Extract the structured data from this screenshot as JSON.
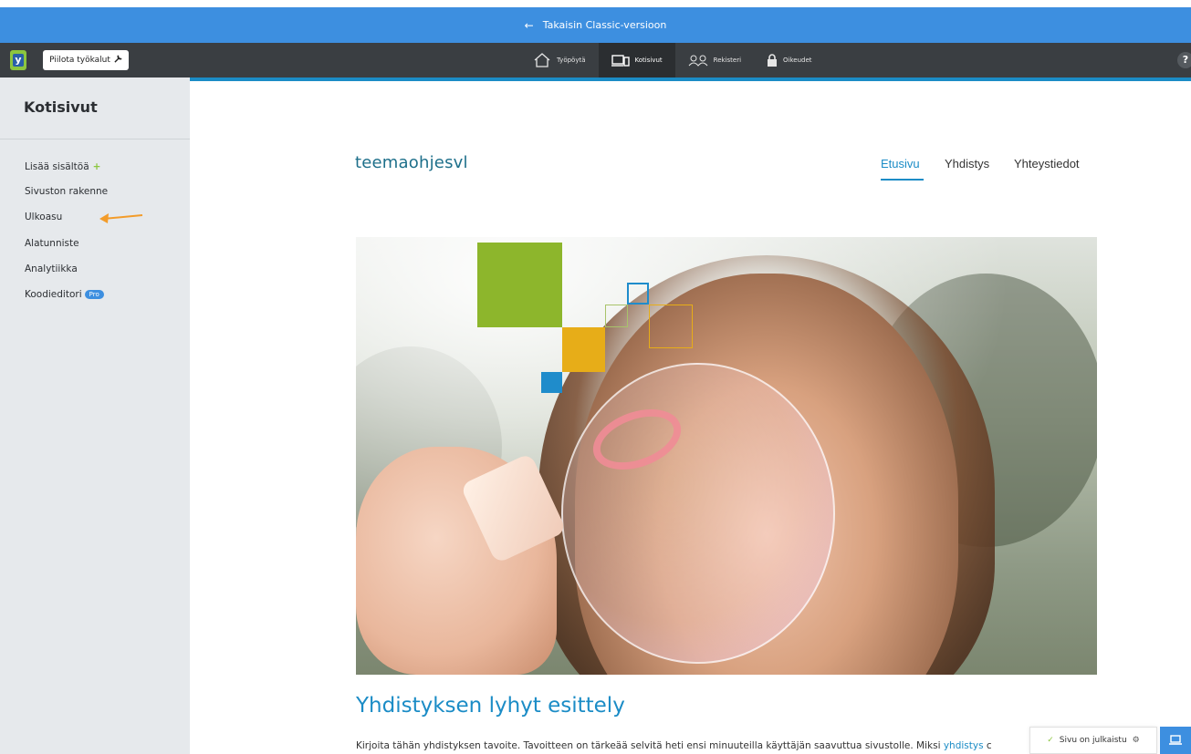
{
  "banner": {
    "back_label": "Takaisin Classic-versioon"
  },
  "toolbar": {
    "logo_letter": "y",
    "hide_tools_label": "Piilota työkalut",
    "nav": [
      {
        "label": "Työpöytä",
        "icon": "home-icon"
      },
      {
        "label": "Kotisivut",
        "icon": "devices-icon",
        "active": true
      },
      {
        "label": "Rekisteri",
        "icon": "people-icon"
      },
      {
        "label": "Oikeudet",
        "icon": "lock-icon"
      }
    ],
    "help_label": "?"
  },
  "sidebar": {
    "title": "Kotisivut",
    "items": [
      {
        "label": "Lisää sisältöä",
        "suffix": "+"
      },
      {
        "label": "Sivuston rakenne"
      },
      {
        "label": "Ulkoasu"
      },
      {
        "label": "Alatunniste"
      },
      {
        "label": "Analytiikka"
      },
      {
        "label": "Koodieditori",
        "badge": "Pro"
      }
    ]
  },
  "site": {
    "logo": "teemaohjesvl",
    "nav": [
      "Etusivu",
      "Yhdistys",
      "Yhteystiedot"
    ],
    "active_nav": "Etusivu",
    "heading": "Yhdistyksen lyhyt esittely",
    "intro_text": "Kirjoita tähän yhdistyksen tavoite. Tavoitteen on tärkeää selvitä heti ensi minuuteilla käyttäjän saavuttua sivustolle. Miksi ",
    "intro_link": "yhdistys",
    "intro_tail": " c"
  },
  "status": {
    "label": "Sivu on julkaistu"
  },
  "colors": {
    "accent": "#1b8cc6",
    "banner": "#3d8fe0",
    "toolbar": "#3a3e42",
    "green": "#8cc63f",
    "orange_arrow": "#f39c2a"
  }
}
